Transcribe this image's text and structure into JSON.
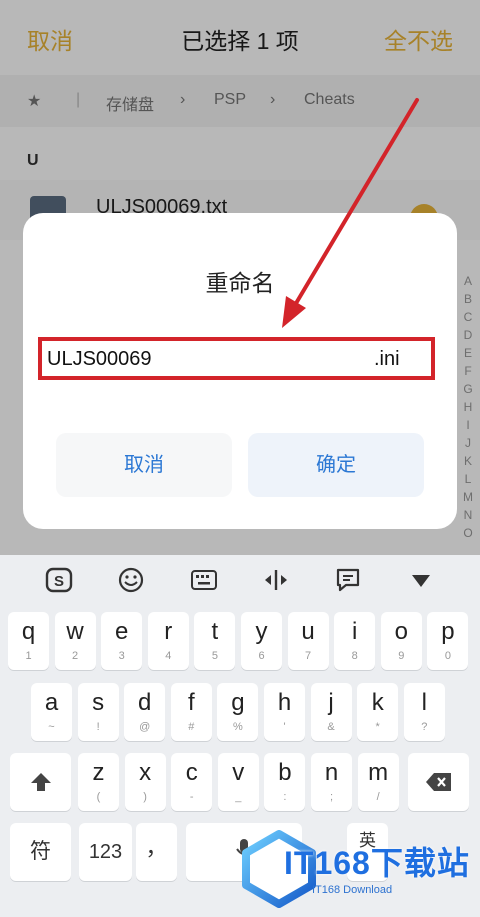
{
  "header": {
    "cancel_label": "取消",
    "title": "已选择 1 项",
    "deselect_label": "全不选"
  },
  "breadcrumb": {
    "items": [
      "存储盘",
      "PSP",
      "Cheats"
    ]
  },
  "list": {
    "section_header": "U",
    "file_name": "ULJS00069.txt"
  },
  "alphabet_index": [
    "A",
    "B",
    "C",
    "D",
    "E",
    "F",
    "G",
    "H",
    "I",
    "J",
    "K",
    "L",
    "M",
    "N",
    "O"
  ],
  "dialog": {
    "title": "重命名",
    "input_name": "ULJS00069",
    "input_extension": ".ini",
    "cancel_label": "取消",
    "confirm_label": "确定"
  },
  "keyboard": {
    "toolbar_icons": [
      "sogou-logo-icon",
      "emoji-icon",
      "keyboard-icon",
      "cursor-move-icon",
      "clipboard-icon",
      "collapse-icon"
    ],
    "row1": [
      {
        "key": "q",
        "sub": "1"
      },
      {
        "key": "w",
        "sub": "2"
      },
      {
        "key": "e",
        "sub": "3"
      },
      {
        "key": "r",
        "sub": "4"
      },
      {
        "key": "t",
        "sub": "5"
      },
      {
        "key": "y",
        "sub": "6"
      },
      {
        "key": "u",
        "sub": "7"
      },
      {
        "key": "i",
        "sub": "8"
      },
      {
        "key": "o",
        "sub": "9"
      },
      {
        "key": "p",
        "sub": "0"
      }
    ],
    "row2": [
      {
        "key": "a",
        "sub": "~"
      },
      {
        "key": "s",
        "sub": "!"
      },
      {
        "key": "d",
        "sub": "@"
      },
      {
        "key": "f",
        "sub": "#"
      },
      {
        "key": "g",
        "sub": "%"
      },
      {
        "key": "h",
        "sub": "'"
      },
      {
        "key": "j",
        "sub": "&"
      },
      {
        "key": "k",
        "sub": "*"
      },
      {
        "key": "l",
        "sub": "?"
      }
    ],
    "row3": [
      {
        "key": "z",
        "sub": "("
      },
      {
        "key": "x",
        "sub": ")"
      },
      {
        "key": "c",
        "sub": "-"
      },
      {
        "key": "v",
        "sub": "_"
      },
      {
        "key": "b",
        "sub": ":"
      },
      {
        "key": "n",
        "sub": ";"
      },
      {
        "key": "m",
        "sub": "/"
      }
    ],
    "symbol_key": "符",
    "number_key": "123",
    "comma_key": "，",
    "language_key": "英"
  },
  "watermark": {
    "brand": "IT168下载站",
    "sub": "IT168 Download"
  },
  "colors": {
    "accent_yellow": "#e8b43a",
    "highlight_red": "#d3242a",
    "button_blue": "#2c78d4"
  }
}
